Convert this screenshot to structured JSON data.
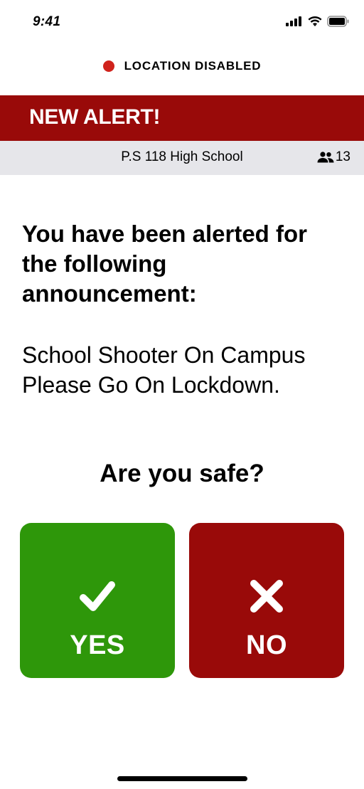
{
  "status_bar": {
    "time": "9:41",
    "icons": [
      "cellular-signal-icon",
      "wifi-icon",
      "battery-icon"
    ]
  },
  "location": {
    "status_text": "LOCATION DISABLED",
    "dot_color": "#d0231c"
  },
  "alert": {
    "title": "NEW ALERT!",
    "banner_color": "#990a09"
  },
  "school": {
    "name": "P.S 118 High School",
    "member_count": "13",
    "member_icon": "group-people-icon",
    "row_color": "#e6e6ea"
  },
  "content": {
    "heading": "You have been alerted for the following announcement:",
    "message_line1": "School Shooter On Campus",
    "message_line2": "Please Go On Lockdown.",
    "question": "Are you safe?"
  },
  "buttons": {
    "yes": {
      "label": "YES",
      "icon": "checkmark-icon",
      "color": "#2e970a"
    },
    "no": {
      "label": "NO",
      "icon": "x-mark-icon",
      "color": "#990a09"
    }
  }
}
